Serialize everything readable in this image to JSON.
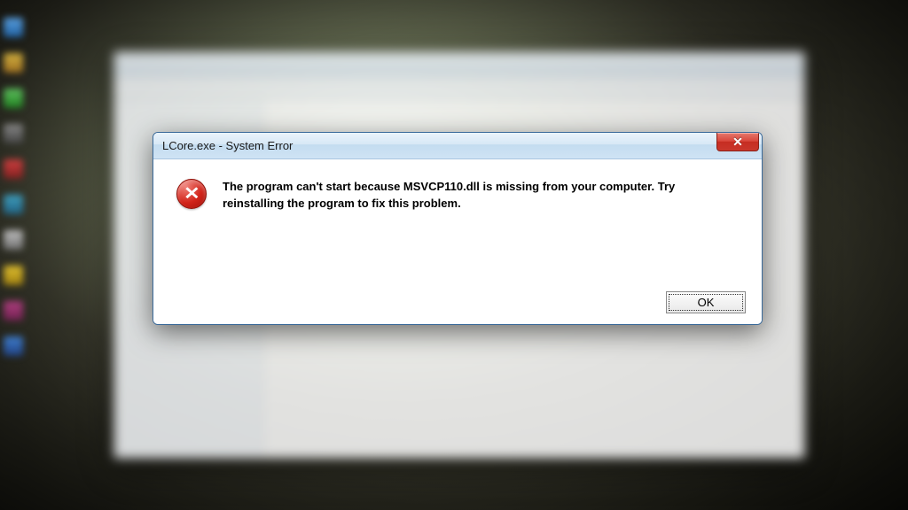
{
  "dialog": {
    "title": "LCore.exe - System Error",
    "message": "The program can't start because MSVCP110.dll is missing from your computer. Try reinstalling the program to fix this problem.",
    "ok_label": "OK",
    "close_glyph": "✕",
    "error_glyph": "✕"
  }
}
